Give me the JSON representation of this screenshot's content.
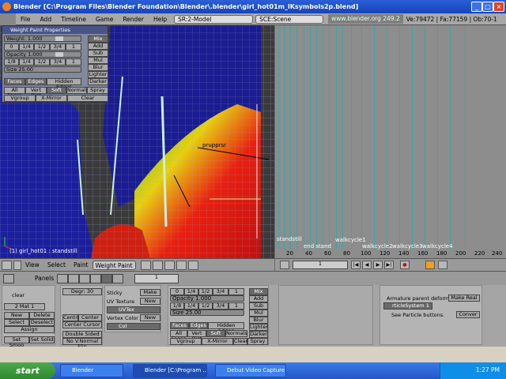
{
  "window": {
    "title": "Blender [C:\\Program Files\\Blender Foundation\\Blender\\.blender\\girl_hot01m_lKsymbols2p.blend]",
    "min": "_",
    "max": "□",
    "close": "×"
  },
  "menubar": {
    "items": [
      "File",
      "Add",
      "Timeline",
      "Game",
      "Render",
      "Help"
    ],
    "screen": "SR:2-Model",
    "scene": "SCE:Scene",
    "url": "www.blender.org 249.2",
    "stats": "Ve:79472 | Fa:77159 | Ob:70-1"
  },
  "weight_panel": {
    "title": "Weight Paint Properties",
    "weight": "Weight: 1.000",
    "weight_presets": [
      "0",
      "1/4",
      "1/2",
      "3/4",
      "1"
    ],
    "opacity": "Opacity 1.000",
    "opacity_presets": [
      "1/8",
      "1/4",
      "1/2",
      "3/4",
      "1"
    ],
    "size": "Size 25.00",
    "modes": [
      "Mix",
      "Add",
      "Sub",
      "Mul",
      "Blur",
      "Lighter",
      "Darker"
    ],
    "display": [
      "Faces",
      "Edges",
      "Hidden Edges"
    ],
    "options": [
      "All Faces",
      "Vert Dist",
      "Soft",
      "Normals",
      "Spray"
    ],
    "row3": [
      "Vgroup",
      "X-Mirror",
      "Clear"
    ]
  },
  "viewport": {
    "object_label": "(1) girl_hot01 : standstill",
    "other_label": "prupprsr"
  },
  "timeline": {
    "markers": [
      "standstill",
      "end stand",
      "walkcycle1",
      "walkcycle2",
      "walkcycle3",
      "walkcycle4"
    ],
    "ticks": [
      "20",
      "40",
      "60",
      "80",
      "100",
      "120",
      "140",
      "160",
      "180",
      "200",
      "220",
      "240"
    ],
    "current_frame": "1"
  },
  "vheader": {
    "items": [
      "View",
      "Select",
      "Paint"
    ],
    "mode": "Weight Paint"
  },
  "buttons": {
    "header_label": "Panels",
    "frame": "1",
    "left": {
      "clear": "clear",
      "mat": "2 Mat 1",
      "btns": [
        "New",
        "Delete",
        "Select",
        "Deselect",
        "Assign"
      ],
      "smooth": [
        "Set Smoo",
        "Set Solid"
      ]
    },
    "mesh": {
      "degr": "Degr: 30",
      "center": [
        "Centre",
        "Center New",
        "Center Cursor"
      ],
      "double": "Double Sided",
      "novnormal": "No V.Normal Flip"
    },
    "uv": {
      "sticky": "Sticky",
      "make": "Make",
      "uvtex": "UV Texture",
      "new": "New",
      "uvtex_name": "UVTex",
      "vcol": "Vertex Color",
      "vcol_name": "Col"
    },
    "wp2": {
      "weight_presets": [
        "0",
        "1/4",
        "1/2",
        "3/4",
        "1"
      ],
      "opacity": "Opacity 1.000",
      "opacity_presets": [
        "1/8",
        "1/4",
        "1/2",
        "3/4",
        "1"
      ],
      "size": "Size 25.00",
      "modes": [
        "Mix",
        "Add",
        "Sub",
        "Mul",
        "Blur",
        "Lighter",
        "Darker"
      ],
      "display": [
        "Faces",
        "Edges",
        "Hidden Edges"
      ],
      "options": [
        "All Faces",
        "Vert Dist",
        "Soft",
        "Normals",
        "Spray"
      ],
      "row3": [
        "Vgroup",
        "X-Mirror",
        "Clear"
      ]
    },
    "modifier": {
      "arm_deform": "Armature parent deform",
      "make_real": "Make Real",
      "ps": "rticleSystem 1",
      "see": "See Particle buttons.",
      "convert": "Conver"
    }
  },
  "taskbar": {
    "start": "start",
    "tasks": [
      "Blender",
      "Blender [C:\\Program ...",
      "Debut Video Capture ..."
    ],
    "clock": "1:27 PM"
  }
}
